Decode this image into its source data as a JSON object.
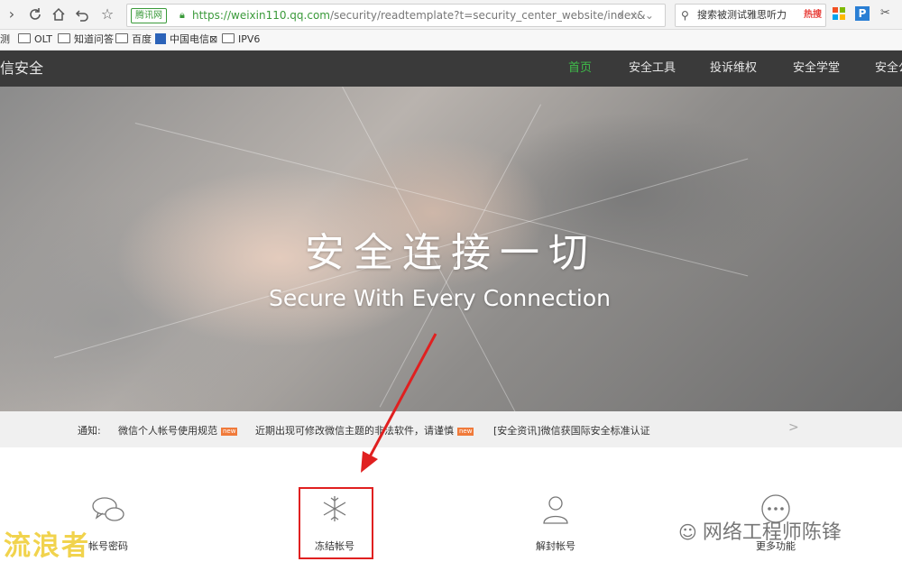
{
  "browser": {
    "url_badge": "腾讯网",
    "url_host": "https://weixin110.qq.com",
    "url_path": "/security/readtemplate?t=security_center_website/index&",
    "search_text": "搜索被测试雅思听力",
    "search_hot": "热搜",
    "bookmarks": [
      "测",
      "OLT",
      "知道问答",
      "百度",
      "中国电信⊠",
      "IPV6"
    ]
  },
  "site": {
    "brand": "信安全",
    "nav": [
      "首页",
      "安全工具",
      "投诉维权",
      "安全学堂",
      "安全公"
    ]
  },
  "hero": {
    "title": "安全连接一切",
    "subtitle": "Secure With Every Connection"
  },
  "notice": {
    "label": "通知:",
    "items": [
      "微信个人帐号使用规范",
      "近期出现可修改微信主题的非法软件，请谨慎",
      "[安全资讯]微信获国际安全标准认证"
    ],
    "new_badge": "new",
    "arrow": ">"
  },
  "features": [
    {
      "label": "帐号密码",
      "icon": "chat-bubbles-icon"
    },
    {
      "label": "冻结帐号",
      "icon": "snowflake-icon"
    },
    {
      "label": "解封帐号",
      "icon": "user-icon"
    },
    {
      "label": "更多功能",
      "icon": "more-icon"
    }
  ],
  "watermarks": {
    "left": "流浪者",
    "right": "网络工程师陈锋"
  },
  "colors": {
    "nav_active": "#3fbf4a",
    "nav_bg": "#3a3a3a",
    "annotation": "#e02020"
  }
}
